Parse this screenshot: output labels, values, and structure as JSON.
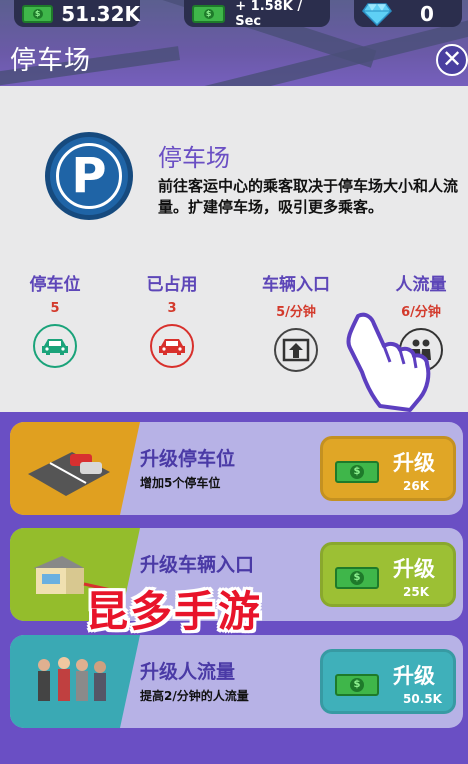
{
  "hud": {
    "cash": "51.32K",
    "income_rate": "+ 1.58K / Sec",
    "gems": "0"
  },
  "header": {
    "title": "停车场",
    "close_symbol": "✕"
  },
  "info": {
    "badge_letter": "P",
    "title": "停车场",
    "description": "前往客运中心的乘客取决于停车场大小和人流量。扩建停车场，吸引更多乘客。"
  },
  "stats": [
    {
      "label": "停车位",
      "value": "5",
      "icon": "car-icon",
      "color": "#1aa37a"
    },
    {
      "label": "已占用",
      "value": "3",
      "icon": "car-icon",
      "color": "#d8302c"
    },
    {
      "label": "车辆入口",
      "value": "5/分钟",
      "icon": "entrance-icon",
      "color": "#444444"
    },
    {
      "label": "人流量",
      "value": "6/分钟",
      "icon": "people-icon",
      "color": "#333333"
    }
  ],
  "upgrades": [
    {
      "title": "升级停车位",
      "subtitle": "增加5个停车位",
      "button_label": "升级",
      "price": "26K",
      "accent": "#e0a020",
      "button_color": "#e0a626"
    },
    {
      "title": "升级车辆入口",
      "subtitle": "",
      "button_label": "升级",
      "price": "25K",
      "accent": "#94bd2c",
      "button_color": "#9cc034"
    },
    {
      "title": "升级人流量",
      "subtitle": "提高2/分钟的人流量",
      "button_label": "升级",
      "price": "50.5K",
      "accent": "#3aa9b4",
      "button_color": "#3fb0ba"
    }
  ],
  "watermark": "昆多手游"
}
